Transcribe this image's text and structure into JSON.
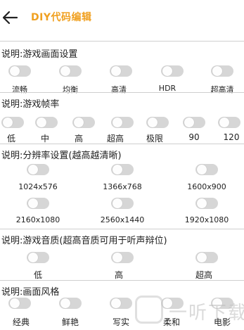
{
  "header": {
    "title": "DIY代码编辑",
    "back_icon": "arrow-left-icon"
  },
  "sections": [
    {
      "title": "说明:游戏画面设置",
      "options": [
        "流畅",
        "均衡",
        "高清",
        "HDR",
        "超高清"
      ]
    },
    {
      "title": "说明:游戏帧率",
      "options": [
        "低",
        "中",
        "高",
        "超高",
        "极限",
        "90",
        "120"
      ]
    },
    {
      "title": "说明:分辨率设置(越高越清晰)",
      "options": [
        "1024x576",
        "1366x768",
        "1600x900",
        "2160x1080",
        "2560x1440",
        "1920x1080"
      ]
    },
    {
      "title": "说明:游戏音质(超高音质可用于听声辩位)",
      "options": [
        "低",
        "高",
        "超高"
      ]
    },
    {
      "title": "说明:画面风格",
      "options": [
        "经典",
        "鲜艳",
        "写实",
        "柔和",
        "电影"
      ]
    }
  ],
  "watermark": {
    "text": "一听下载"
  },
  "colors": {
    "accent": "#f0a020",
    "toggle_off": "#d6d6d6",
    "divider": "#cfcfcf"
  }
}
